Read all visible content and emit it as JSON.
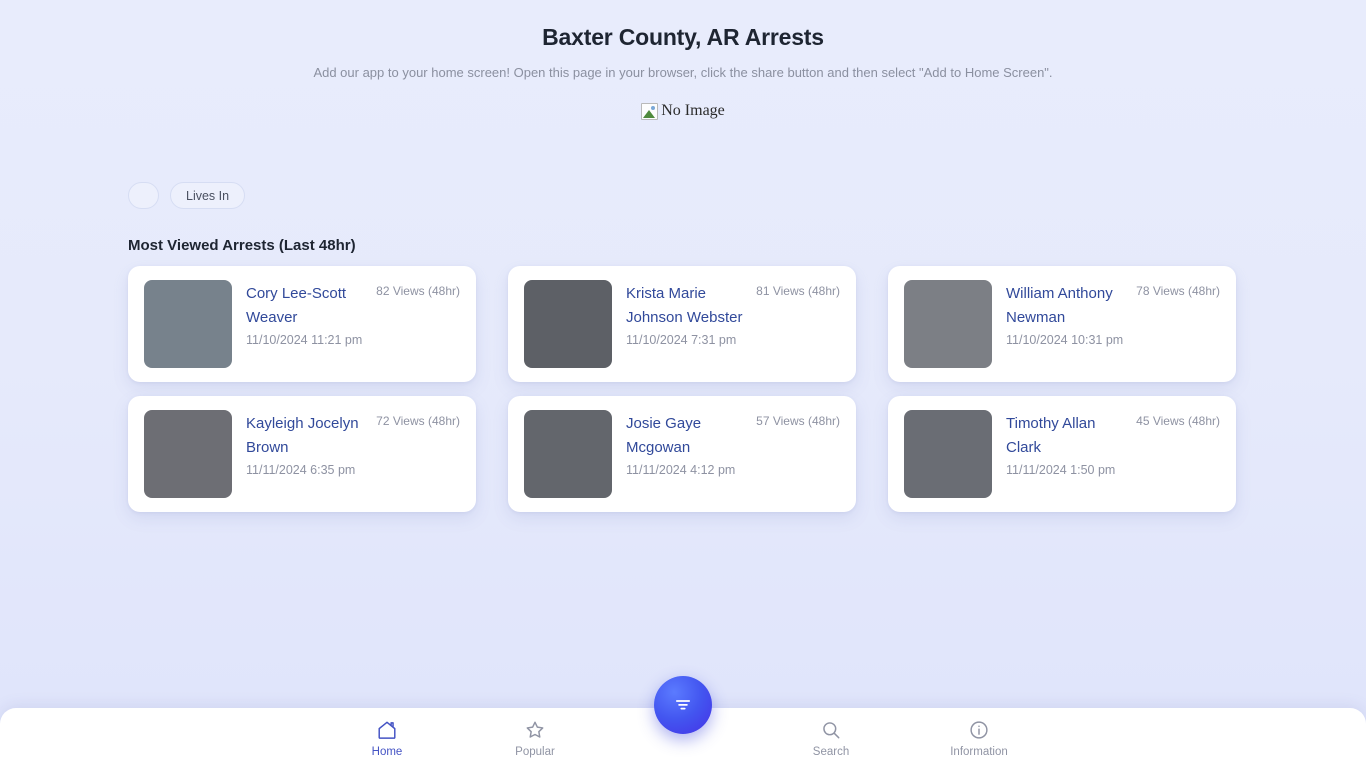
{
  "header": {
    "title": "Baxter County, AR Arrests",
    "subtitle": "Add our app to your home screen! Open this page in your browser, click the share button and then select \"Add to Home Screen\".",
    "hero_image_alt": "No Image"
  },
  "filters": {
    "chips": [
      {
        "label": "",
        "name": "filter-chip-blank"
      },
      {
        "label": "Lives In",
        "name": "filter-chip-lives-in"
      }
    ]
  },
  "section": {
    "heading": "Most Viewed Arrests (Last 48hr)"
  },
  "arrests": [
    {
      "name": "Cory Lee-Scott Weaver",
      "booked": "11/10/2024 11:21 pm",
      "views": "82 Views (48hr)",
      "photo_bg": "#77828c",
      "photo_alt": "mugshot-cory-lee-scott-weaver"
    },
    {
      "name": "Krista Marie Johnson Webster",
      "booked": "11/10/2024 7:31 pm",
      "views": "81 Views (48hr)",
      "photo_bg": "#5d6066",
      "photo_alt": "mugshot-krista-marie-johnson-webster"
    },
    {
      "name": "William Anthony Newman",
      "booked": "11/10/2024 10:31 pm",
      "views": "78 Views (48hr)",
      "photo_bg": "#7c7f85",
      "photo_alt": "mugshot-william-anthony-newman"
    },
    {
      "name": "Kayleigh Jocelyn Brown",
      "booked": "11/11/2024 6:35 pm",
      "views": "72 Views (48hr)",
      "photo_bg": "#6d6e74",
      "photo_alt": "mugshot-kayleigh-jocelyn-brown"
    },
    {
      "name": "Josie Gaye Mcgowan",
      "booked": "11/11/2024 4:12 pm",
      "views": "57 Views (48hr)",
      "photo_bg": "#63666c",
      "photo_alt": "mugshot-josie-gaye-mcgowan"
    },
    {
      "name": "Timothy Allan Clark",
      "booked": "11/11/2024 1:50 pm",
      "views": "45 Views (48hr)",
      "photo_bg": "#6a6d74",
      "photo_alt": "mugshot-timothy-allan-clark"
    }
  ],
  "bottom_nav": {
    "items": [
      {
        "label": "Home",
        "icon": "home-icon",
        "active": true
      },
      {
        "label": "Popular",
        "icon": "star-icon",
        "active": false
      },
      {
        "label": "Search",
        "icon": "search-icon",
        "active": false
      },
      {
        "label": "Information",
        "icon": "info-icon",
        "active": false
      }
    ],
    "fab_icon": "filter-icon"
  },
  "colors": {
    "accent": "#4453c4",
    "link": "#31499a",
    "muted": "#8e92a2",
    "fab": "#4356f0"
  }
}
